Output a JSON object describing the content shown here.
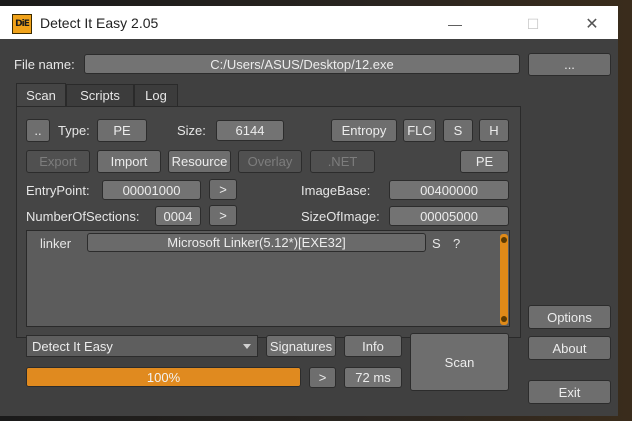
{
  "window": {
    "title": "Detect It Easy 2.05",
    "logo_text": "DiE",
    "minimize_glyph": "—",
    "maximize_glyph": "☐",
    "close_glyph": "✕"
  },
  "file": {
    "label": "File name:",
    "path": "C:/Users/ASUS/Desktop/12.exe",
    "browse_label": "..."
  },
  "tabs": [
    {
      "label": "Scan",
      "active": true
    },
    {
      "label": "Scripts",
      "active": false
    },
    {
      "label": "Log",
      "active": false
    }
  ],
  "row1": {
    "dotdot_label": "..",
    "type_label": "Type:",
    "type_value": "PE",
    "size_label": "Size:",
    "size_value": "6144",
    "entropy_label": "Entropy",
    "flc_label": "FLC",
    "s_label": "S",
    "h_label": "H"
  },
  "row2": {
    "export_label": "Export",
    "import_label": "Import",
    "resource_label": "Resource",
    "overlay_label": "Overlay",
    "net_label": ".NET",
    "pe_label": "PE"
  },
  "pe_info": {
    "entrypoint_label": "EntryPoint:",
    "entrypoint_value": "00001000",
    "imagebase_label": "ImageBase:",
    "imagebase_value": "00400000",
    "sections_label": "NumberOfSections:",
    "sections_value": "0004",
    "sizeofimage_label": "SizeOfImage:",
    "sizeofimage_value": "00005000",
    "arrow_label": ">"
  },
  "results": [
    {
      "type": "linker",
      "name": "Microsoft Linker(5.12*)[EXE32]",
      "s": "S",
      "q": "?"
    }
  ],
  "bottom": {
    "database": "Detect It Easy",
    "signatures_label": "Signatures",
    "info_label": "Info",
    "scan_label": "Scan",
    "progress_text": "100%",
    "progress_value": 1.0,
    "arrow_label": ">",
    "time": "72 ms"
  },
  "side": {
    "options_label": "Options",
    "about_label": "About",
    "exit_label": "Exit"
  },
  "colors": {
    "accent": "#e08a1f",
    "window_bg": "#404040",
    "button_bg": "#6e6e6e"
  }
}
